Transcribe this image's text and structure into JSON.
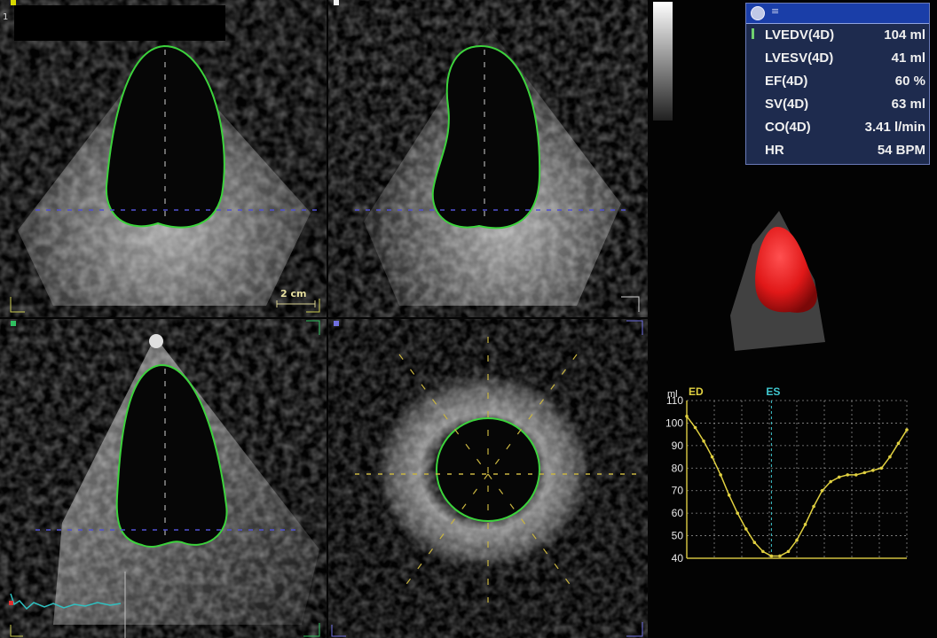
{
  "panels": {
    "top_left": {
      "pane_id": "1"
    },
    "scale_bar": {
      "label": "2 cm"
    }
  },
  "measurements": {
    "header_icon": "settings-globe-icon",
    "header_text": "≡",
    "rows": [
      {
        "label": "LVEDV(4D)",
        "value": "104 ml",
        "selected": true
      },
      {
        "label": "LVESV(4D)",
        "value": "41 ml",
        "selected": false
      },
      {
        "label": "EF(4D)",
        "value": "60 %",
        "selected": false
      },
      {
        "label": "SV(4D)",
        "value": "63 ml",
        "selected": false
      },
      {
        "label": "CO(4D)",
        "value": "3.41 l/min",
        "selected": false
      },
      {
        "label": "HR",
        "value": "54 BPM",
        "selected": false
      }
    ]
  },
  "volume_render": {
    "color": "#e01818"
  },
  "colors": {
    "endocardial_contour": "#3cd23c",
    "crosshair_blue": "#5050d0",
    "crosshair_yellow": "#c8b440",
    "curve": "#e0d040",
    "es_marker": "#40c8d0",
    "ecg_trace": "#30c0c0"
  },
  "chart_data": {
    "type": "line",
    "title": "",
    "xlabel": "",
    "ylabel": "ml",
    "ylim": [
      40,
      110
    ],
    "yticks": [
      40,
      50,
      60,
      70,
      80,
      90,
      100,
      110
    ],
    "markers": [
      {
        "label": "ED",
        "x": 0
      },
      {
        "label": "ES",
        "x": 10
      }
    ],
    "x": [
      0,
      1,
      2,
      3,
      4,
      5,
      6,
      7,
      8,
      9,
      10,
      11,
      12,
      13,
      14,
      15,
      16,
      17,
      18,
      19,
      20,
      21,
      22,
      23,
      24,
      25,
      26
    ],
    "series": [
      {
        "name": "",
        "values": [
          103,
          98,
          92,
          85,
          77,
          68,
          60,
          53,
          47,
          43,
          41,
          41,
          43,
          48,
          55,
          63,
          70,
          74,
          76,
          77,
          77,
          78,
          79,
          80,
          85,
          91,
          97
        ]
      }
    ]
  }
}
